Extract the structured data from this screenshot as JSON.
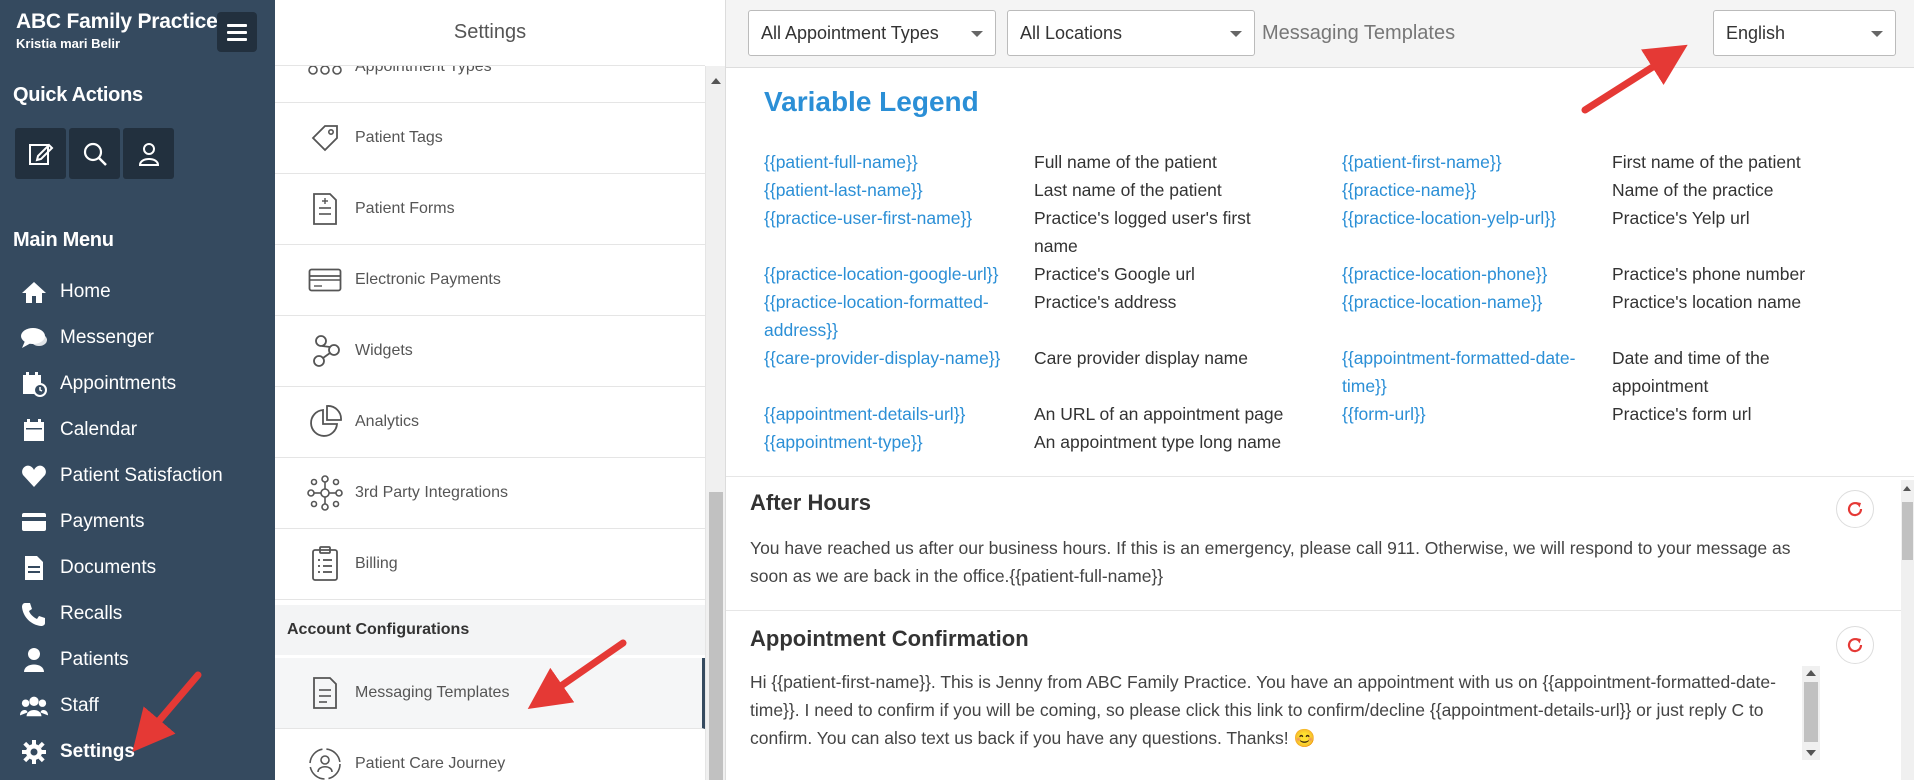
{
  "brand": {
    "name": "ABC Family Practice",
    "user": "Kristia mari Belir"
  },
  "quick_actions": {
    "title": "Quick Actions",
    "buttons": [
      "compose-icon",
      "search-icon",
      "user-icon"
    ]
  },
  "main_menu": {
    "title": "Main Menu",
    "items": [
      {
        "label": "Home",
        "icon": "home-icon"
      },
      {
        "label": "Messenger",
        "icon": "chat-icon"
      },
      {
        "label": "Appointments",
        "icon": "calendar-clock-icon"
      },
      {
        "label": "Calendar",
        "icon": "calendar-icon"
      },
      {
        "label": "Patient Satisfaction",
        "icon": "heart-icon"
      },
      {
        "label": "Payments",
        "icon": "credit-card-icon"
      },
      {
        "label": "Documents",
        "icon": "document-icon"
      },
      {
        "label": "Recalls",
        "icon": "phone-icon"
      },
      {
        "label": "Patients",
        "icon": "user-icon"
      },
      {
        "label": "Staff",
        "icon": "users-icon"
      },
      {
        "label": "Settings",
        "icon": "gear-icon",
        "active": true
      }
    ]
  },
  "settings": {
    "title": "Settings",
    "items": [
      {
        "label": "Appointment Types",
        "icon": "appointment-types-icon"
      },
      {
        "label": "Patient Tags",
        "icon": "tag-icon"
      },
      {
        "label": "Patient Forms",
        "icon": "form-icon"
      },
      {
        "label": "Electronic Payments",
        "icon": "card-icon"
      },
      {
        "label": "Widgets",
        "icon": "widgets-icon"
      },
      {
        "label": "Analytics",
        "icon": "pie-chart-icon"
      },
      {
        "label": "3rd Party Integrations",
        "icon": "network-icon"
      },
      {
        "label": "Billing",
        "icon": "clipboard-icon"
      }
    ],
    "account_config_header": "Account Configurations",
    "account_items": [
      {
        "label": "Messaging Templates",
        "icon": "template-icon",
        "active": true
      },
      {
        "label": "Patient Care Journey",
        "icon": "journey-icon"
      }
    ]
  },
  "topbar": {
    "appointment_types": "All Appointment Types",
    "locations": "All Locations",
    "label": "Messaging Templates",
    "language": "English"
  },
  "legend": {
    "title": "Variable Legend",
    "entries": [
      {
        "var": "{{patient-full-name}}",
        "desc": "Full name of the patient"
      },
      {
        "var": "{{patient-first-name}}",
        "desc": "First name of the patient"
      },
      {
        "var": "{{patient-last-name}}",
        "desc": "Last name of the patient"
      },
      {
        "var": "{{practice-name}}",
        "desc": "Name of the practice"
      },
      {
        "var": "{{practice-user-first-name}}",
        "desc": "Practice's logged user's first name"
      },
      {
        "var": "{{practice-location-yelp-url}}",
        "desc": "Practice's Yelp url"
      },
      {
        "var": "{{practice-location-google-url}}",
        "desc": "Practice's Google url"
      },
      {
        "var": "{{practice-location-phone}}",
        "desc": "Practice's phone number"
      },
      {
        "var": "{{practice-location-formatted-address}}",
        "desc": "Practice's address"
      },
      {
        "var": "{{practice-location-name}}",
        "desc": "Practice's location name"
      },
      {
        "var": "{{care-provider-display-name}}",
        "desc": "Care provider display name"
      },
      {
        "var": "{{appointment-formatted-date-time}}",
        "desc": "Date and time of the appointment"
      },
      {
        "var": "{{appointment-details-url}}",
        "desc": "An URL of an appointment page"
      },
      {
        "var": "{{form-url}}",
        "desc": "Practice's form url"
      },
      {
        "var": "{{appointment-type}}",
        "desc": "An appointment type long name"
      }
    ]
  },
  "templates": [
    {
      "title": "After Hours",
      "body": "You have reached us after our business hours. If this is an emergency, please call 911. Otherwise, we will respond to your message as soon as we are back in the office.{{patient-full-name}}"
    },
    {
      "title": "Appointment Confirmation",
      "body": "Hi {{patient-first-name}}. This is Jenny from ABC Family Practice.  You have an appointment with us on {{appointment-formatted-date-time}}.  I need to confirm if you will be coming, so please click this link to confirm/decline {{appointment-details-url}} or just reply C to confirm. You can also text us back if you have any questions. Thanks! 😊"
    }
  ],
  "colors": {
    "sidebar": "#354a5f",
    "accent": "#2b8fd6",
    "arrow": "#e53935"
  }
}
